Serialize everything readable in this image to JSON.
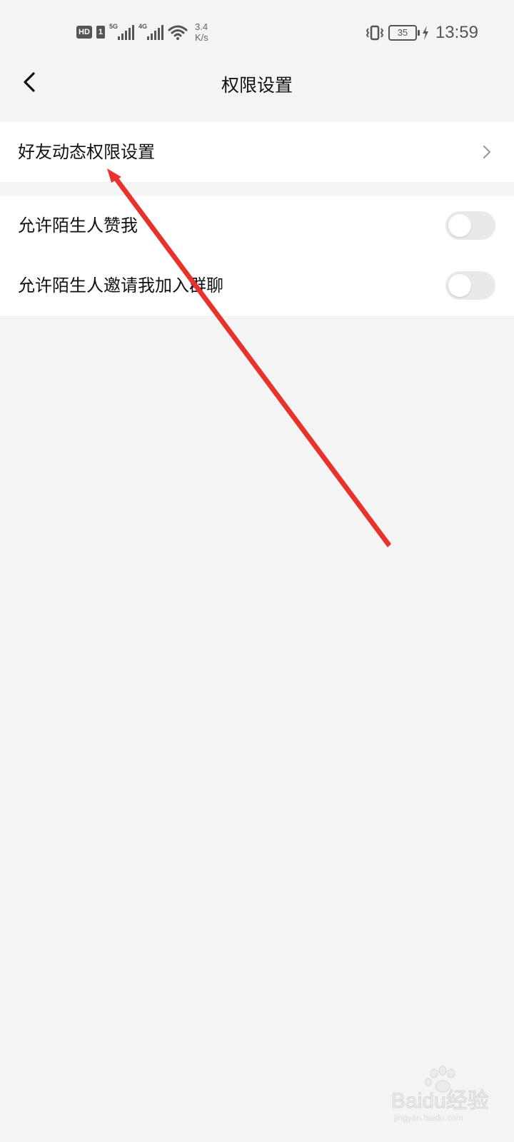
{
  "status_bar": {
    "hd_badge": "HD",
    "sim_badge": "1",
    "net1_label": "5G",
    "net2_label": "4G",
    "speed_value": "3.4",
    "speed_unit": "K/s",
    "battery": "35",
    "time": "13:59"
  },
  "header": {
    "back_icon": "chevron-left-icon",
    "title": "权限设置"
  },
  "menu": {
    "friend_feed": {
      "label": "好友动态权限设置",
      "icon": "chevron-right-icon"
    },
    "allow_stranger_likes": {
      "label": "允许陌生人赞我",
      "enabled": false
    },
    "allow_stranger_group_invite": {
      "label": "允许陌生人邀请我加入群聊",
      "enabled": false
    }
  },
  "watermark": {
    "brand": "Baidu经验",
    "url": "jingyan.baidu.com"
  },
  "colors": {
    "page_bg": "#f4f4f5",
    "toggle_off": "#e9e9ea",
    "annotation_arrow": "#e8322c"
  }
}
